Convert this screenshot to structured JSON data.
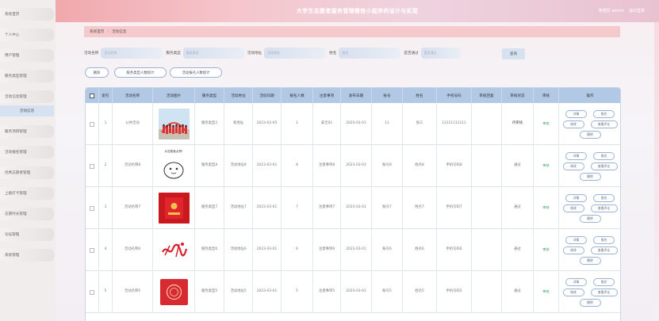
{
  "header": {
    "title": "大学生志愿者服务管理微信小程序的设计与实现",
    "user": "管理员 admin",
    "logout": "退出登录"
  },
  "sidebar": {
    "items": [
      {
        "label": "系统首页",
        "chev": false
      },
      {
        "label": "个人中心",
        "chev": true
      },
      {
        "label": "用户管理",
        "chev": true
      },
      {
        "label": "服务类型管理",
        "chev": true
      },
      {
        "label": "活动信息管理",
        "chev": true
      },
      {
        "label": "服务项目管理",
        "chev": true
      },
      {
        "label": "活动报名管理",
        "chev": true
      },
      {
        "label": "优秀志愿者管理",
        "chev": true
      },
      {
        "label": "上报打卡管理",
        "chev": true
      },
      {
        "label": "志愿时长管理",
        "chev": true
      },
      {
        "label": "论坛管理",
        "chev": true
      },
      {
        "label": "系统管理",
        "chev": true
      }
    ],
    "active_sub": "活动信息"
  },
  "breadcrumb": {
    "home": "系统首页",
    "sep": "/",
    "current": "活动信息"
  },
  "search": {
    "fields": [
      {
        "label": "活动名称",
        "placeholder": "活动名称"
      },
      {
        "label": "服务类型",
        "placeholder": "服务类型"
      },
      {
        "label": "活动地址",
        "placeholder": "活动地址"
      },
      {
        "label": "姓名",
        "placeholder": "姓名"
      },
      {
        "label": "是否通过",
        "placeholder": "是否通过"
      }
    ],
    "query_button": "查询"
  },
  "actions": {
    "delete": "删除",
    "stat1": "服务类型人数统计",
    "stat2": "活动报名人数统计"
  },
  "table": {
    "headers": [
      "",
      "索引",
      "活动名称",
      "活动图片",
      "服务类型",
      "活动地址",
      "活动日期",
      "报名人数",
      "注意事项",
      "发布日期",
      "账号",
      "姓名",
      "手机号码",
      "审核回复",
      "审核状态",
      "审核",
      "操作"
    ],
    "rows": [
      {
        "index": "1",
        "name": "公共活动",
        "image": "photo",
        "type": "服务类型2",
        "addr": "某地址",
        "date": "2023-03-05",
        "count": "1",
        "note": "安全01",
        "pub": "2023-03-01",
        "acct": "11",
        "uname": "张三",
        "phone": "13111111111",
        "reply": "",
        "status": "待审核",
        "audit": "审核"
      },
      {
        "index": "2",
        "name": "活动名称8",
        "image": "meme",
        "image_caption": "为志愿者点赞!",
        "type": "服务类型8",
        "addr": "活动地址8",
        "date": "2023-03-01",
        "count": "8",
        "note": "注意事项8",
        "pub": "2023-03-01",
        "acct": "账号8",
        "uname": "姓名8",
        "phone": "手机号码8",
        "reply": "",
        "status": "通过",
        "audit": "审核"
      },
      {
        "index": "3",
        "name": "活动名称7",
        "image": "redenv",
        "type": "服务类型7",
        "addr": "活动地址7",
        "date": "2023-03-01",
        "count": "7",
        "note": "注意事项7",
        "pub": "2023-03-01",
        "acct": "账号7",
        "uname": "姓名7",
        "phone": "手机号码7",
        "reply": "",
        "status": "通过",
        "audit": "审核"
      },
      {
        "index": "4",
        "name": "活动名称6",
        "image": "calli",
        "type": "服务类型6",
        "addr": "活动地址6",
        "date": "2023-03-01",
        "count": "6",
        "note": "注意事项6",
        "pub": "2023-03-01",
        "acct": "账号6",
        "uname": "姓名6",
        "phone": "手机号码6",
        "reply": "",
        "status": "通过",
        "audit": "审核"
      },
      {
        "index": "5",
        "name": "活动名称5",
        "image": "redbox",
        "type": "服务类型5",
        "addr": "活动地址5",
        "date": "2023-03-01",
        "count": "5",
        "note": "注意事项5",
        "pub": "2023-03-01",
        "acct": "账号5",
        "uname": "姓名5",
        "phone": "手机号码5",
        "reply": "",
        "status": "通过",
        "audit": "审核"
      }
    ],
    "ops": {
      "detail": "详情",
      "report": "报名",
      "edit": "修改",
      "comment": "查看评论",
      "del": "删除"
    }
  },
  "colors": {
    "header_bg": "#f3b9be",
    "table_head": "#b2c9e6",
    "accent_blue": "#9ab3d4",
    "audit_green": "#35a35a",
    "breadcrumb_bg": "#f6c9cc"
  }
}
